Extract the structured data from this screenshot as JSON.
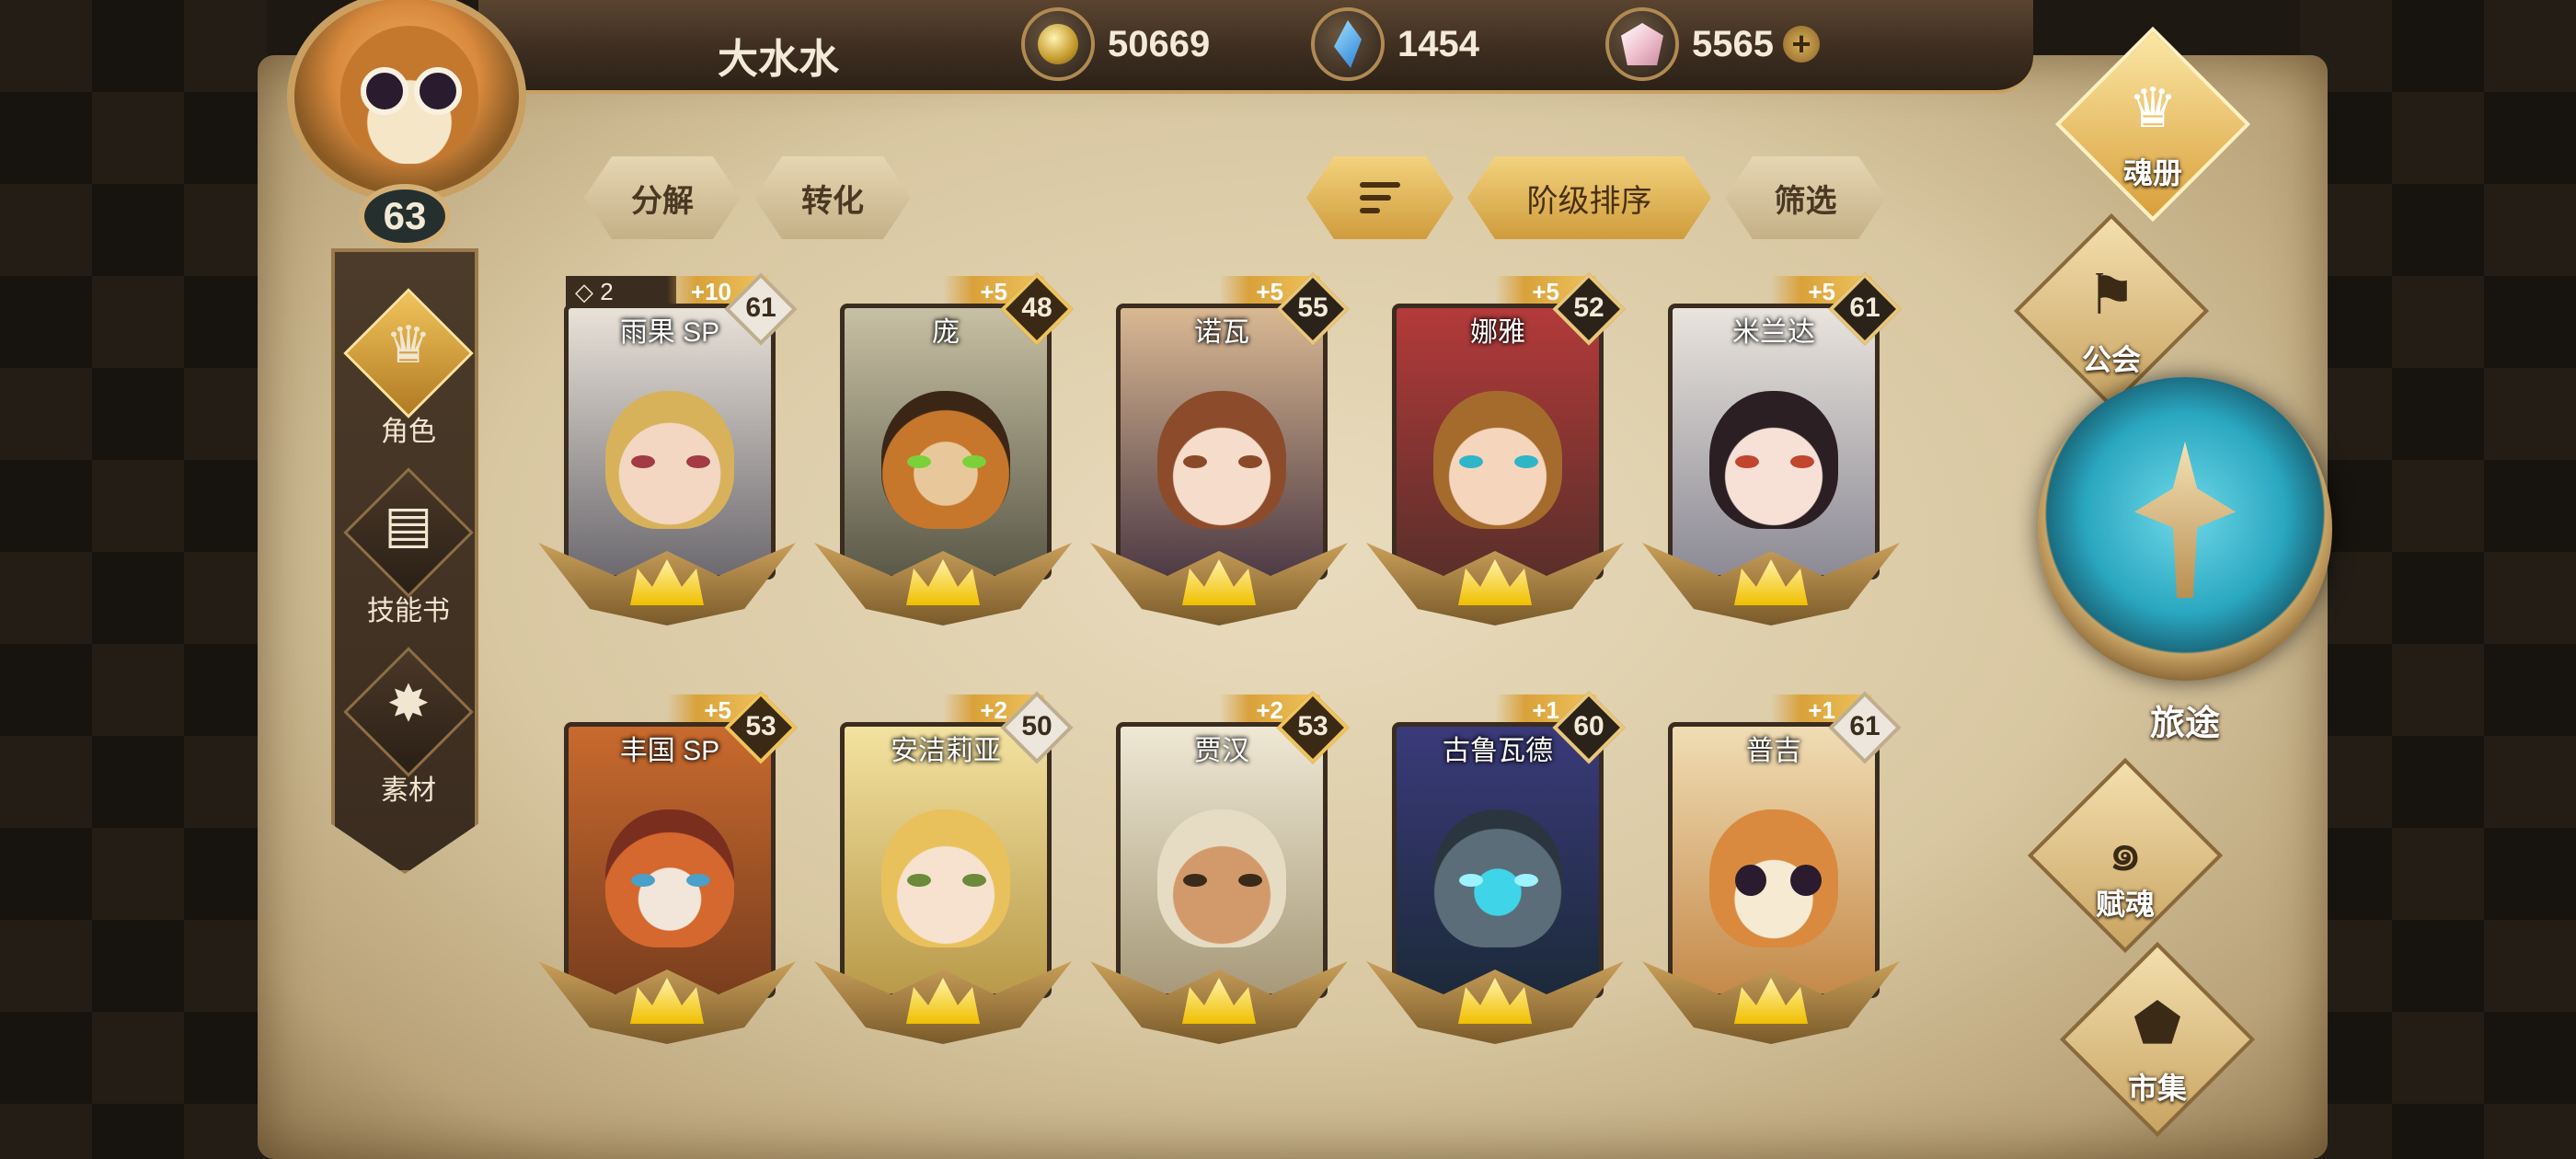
{
  "player": {
    "name": "大水水",
    "level": "63"
  },
  "currencies": {
    "gold": "50669",
    "crystal": "1454",
    "gem": "5565",
    "add_label": "+"
  },
  "left_menu": [
    {
      "label": "角色",
      "icon": "helmet-icon",
      "active": true
    },
    {
      "label": "技能书",
      "icon": "skillbook-icon",
      "active": false
    },
    {
      "label": "素材",
      "icon": "materials-icon",
      "active": false
    }
  ],
  "actions": {
    "decompose": "分解",
    "convert": "转化",
    "sort_by_rank": "阶级排序",
    "filter": "筛选"
  },
  "heroes": [
    {
      "name": "雨果 SP",
      "level": "61",
      "plus": "+10",
      "stars": "2"
    },
    {
      "name": "庞",
      "level": "48",
      "plus": "+5"
    },
    {
      "name": "诺瓦",
      "level": "55",
      "plus": "+5"
    },
    {
      "name": "娜雅",
      "level": "52",
      "plus": "+5"
    },
    {
      "name": "米兰达",
      "level": "61",
      "plus": "+5"
    },
    {
      "name": "丰国 SP",
      "level": "53",
      "plus": "+5"
    },
    {
      "name": "安洁莉亚",
      "level": "50",
      "plus": "+2"
    },
    {
      "name": "贾汉",
      "level": "53",
      "plus": "+2"
    },
    {
      "name": "古鲁瓦德",
      "level": "60",
      "plus": "+1"
    },
    {
      "name": "普吉",
      "level": "61",
      "plus": "+1"
    }
  ],
  "right_nav": {
    "soulbook": "魂册",
    "guild": "公会",
    "journey": "旅途",
    "talent": "赋魂",
    "market": "市集"
  },
  "colors": {
    "gold_accent": "#f0c45c",
    "parchment": "#e3d3b0",
    "dark_wood": "#3a2c1f",
    "journey_teal": "#2aa7c0"
  }
}
